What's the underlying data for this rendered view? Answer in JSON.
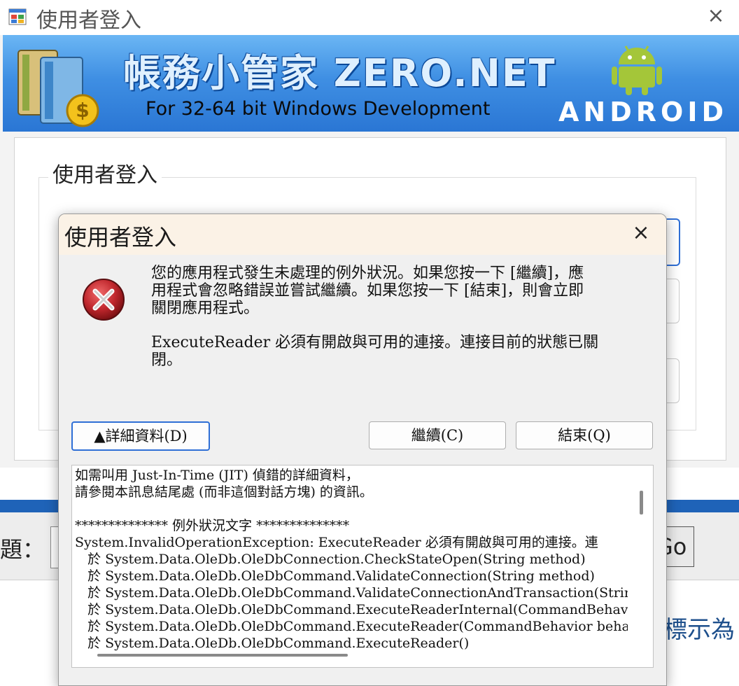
{
  "login_window": {
    "title": "使用者登入",
    "close_glyph": "×",
    "banner": {
      "title": "帳務小管家 ZERO.NET",
      "subtitle": "For 32-64 bit Windows Development",
      "android_wordmark": "ANDROID"
    },
    "group_label": "使用者登入"
  },
  "background_page": {
    "label": "題：",
    "button_label": "Go",
    "hint_text": "標示為"
  },
  "error_dialog": {
    "title": "使用者登入",
    "close_glyph": "×",
    "icon": "error-icon",
    "message_paragraph_1_lines": [
      "您的應用程式發生未處理的例外狀況。如果您按一下 [繼續]，應",
      "用程式會忽略錯誤並嘗試繼續。如果您按一下 [結束]，則會立即",
      "關閉應用程式。"
    ],
    "message_paragraph_2_lines": [
      "ExecuteReader 必須有開啟與可用的連接。連接目前的狀態已關",
      "閉。"
    ],
    "buttons": {
      "details": "▲詳細資料(D)",
      "continue": "繼續(C)",
      "quit": "結束(Q)"
    },
    "details_lines": [
      "如需叫用 Just-In-Time (JIT) 偵錯的詳細資料，",
      "請參閱本訊息結尾處 (而非這個對話方塊) 的資訊。",
      "",
      "************** 例外狀況文字 **************",
      "System.InvalidOperationException: ExecuteReader 必須有開啟與可用的連接。連",
      "   於 System.Data.OleDb.OleDbConnection.CheckStateOpen(String method)",
      "   於 System.Data.OleDb.OleDbCommand.ValidateConnection(String method)",
      "   於 System.Data.OleDb.OleDbCommand.ValidateConnectionAndTransaction(String",
      "   於 System.Data.OleDb.OleDbCommand.ExecuteReaderInternal(CommandBehavio",
      "   於 System.Data.OleDb.OleDbCommand.ExecuteReader(CommandBehavior behav",
      "   於 System.Data.OleDb.OleDbCommand.ExecuteReader()"
    ]
  },
  "colors": {
    "accent_blue": "#2f6fd6",
    "banner_blue": "#3f8fe3",
    "error_red": "#c0272d",
    "android_green": "#a4c639"
  }
}
